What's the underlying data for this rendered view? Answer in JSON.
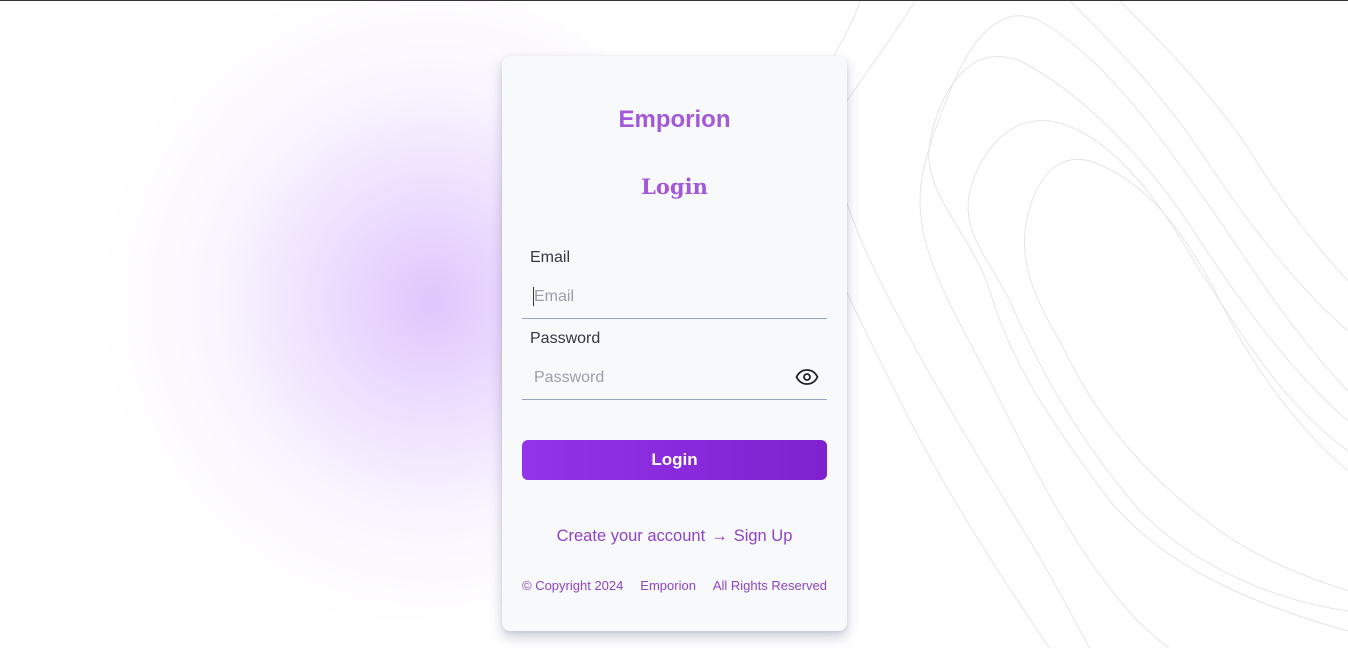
{
  "brand": {
    "name": "Emporion",
    "color": "#a259d9"
  },
  "form": {
    "heading": "Login",
    "email": {
      "label": "Email",
      "placeholder": "Email",
      "value": ""
    },
    "password": {
      "label": "Password",
      "placeholder": "Password",
      "value": "",
      "toggle_icon": "eye-icon"
    },
    "submit_label": "Login",
    "button_color": "#9333ea"
  },
  "signup": {
    "prompt": "Create your account",
    "arrow": "→",
    "link_label": "Sign Up"
  },
  "footer": {
    "copyright": "© Copyright 2024",
    "company": "Emporion",
    "rights": "All Rights Reserved"
  }
}
